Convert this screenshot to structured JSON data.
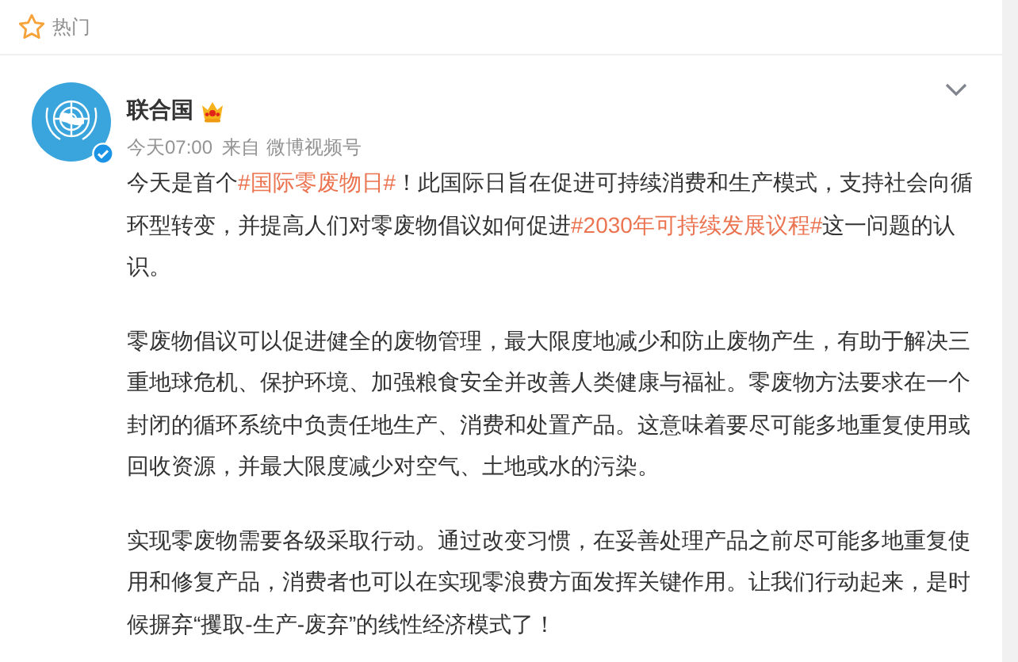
{
  "section": {
    "title": "热门"
  },
  "post": {
    "author": "联合国",
    "time": "今天07:00",
    "source_prefix": "来自",
    "source": "微博视频号",
    "verified": true,
    "paragraphs": [
      [
        {
          "kind": "text",
          "text": "今天是首个"
        },
        {
          "kind": "topic",
          "text": "#国际零废物日#"
        },
        {
          "kind": "text",
          "text": "！此国际日旨在促进可持续消费和生产模式，支持社会向循环型转变，并提高人们对零废物倡议如何促进"
        },
        {
          "kind": "topic",
          "text": "#2030年可持续发展议程#"
        },
        {
          "kind": "text",
          "text": "这一问题的认识。"
        }
      ],
      [
        {
          "kind": "text",
          "text": "零废物倡议可以促进健全的废物管理，最大限度地减少和防止废物产生，有助于解决三重地球危机、保护环境、加强粮食安全并改善人类健康与福祉。零废物方法要求在一个封闭的循环系统中负责任地生产、消费和处置产品。这意味着要尽可能多地重复使用或回收资源，并最大限度减少对空气、土地或水的污染。"
        }
      ],
      [
        {
          "kind": "text",
          "text": "实现零废物需要各级采取行动。通过改变习惯，在妥善处理产品之前尽可能多地重复使用和修复产品，消费者也可以在实现零浪费方面发挥关键作用。让我们行动起来，是时候摒弃“攫取-生产-废弃”的线性经济模式了！"
        }
      ]
    ]
  }
}
